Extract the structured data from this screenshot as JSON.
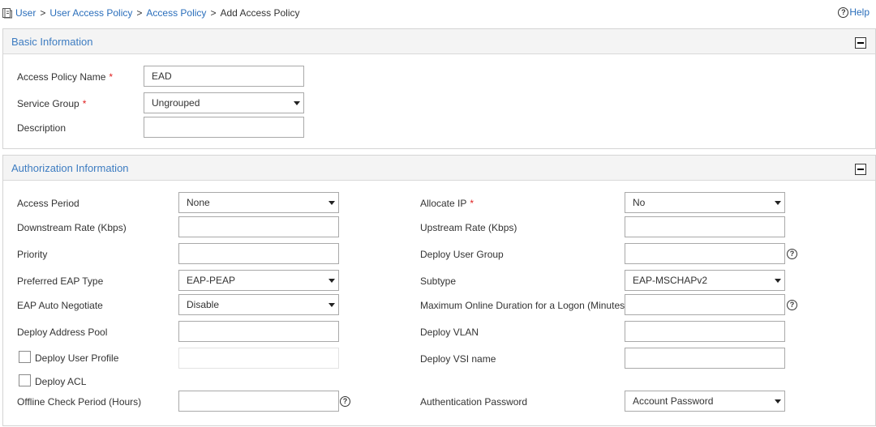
{
  "breadcrumb": {
    "items": [
      "User",
      "User Access Policy",
      "Access Policy",
      "Add Access Policy"
    ],
    "separator": ">"
  },
  "help": {
    "label": "Help"
  },
  "basic": {
    "title": "Basic Information",
    "policy_name": {
      "label": "Access Policy Name",
      "value": "EAD"
    },
    "service_group": {
      "label": "Service Group",
      "value": "Ungrouped"
    },
    "description": {
      "label": "Description",
      "value": ""
    },
    "required_mark": "*"
  },
  "auth": {
    "title": "Authorization Information",
    "access_period": {
      "label": "Access Period",
      "value": "None"
    },
    "downstream_rate": {
      "label": "Downstream Rate (Kbps)",
      "value": ""
    },
    "priority": {
      "label": "Priority",
      "value": ""
    },
    "preferred_eap_type": {
      "label": "Preferred EAP Type",
      "value": "EAP-PEAP"
    },
    "eap_auto_negotiate": {
      "label": "EAP Auto Negotiate",
      "value": "Disable"
    },
    "deploy_address_pool": {
      "label": "Deploy Address Pool",
      "value": ""
    },
    "deploy_user_profile": {
      "label": "Deploy User Profile",
      "checked": false,
      "value": ""
    },
    "deploy_acl": {
      "label": "Deploy ACL",
      "checked": false
    },
    "offline_check_period": {
      "label": "Offline Check Period (Hours)",
      "value": ""
    },
    "allocate_ip": {
      "label": "Allocate IP",
      "value": "No"
    },
    "upstream_rate": {
      "label": "Upstream Rate (Kbps)",
      "value": ""
    },
    "deploy_user_group": {
      "label": "Deploy User Group",
      "value": ""
    },
    "subtype": {
      "label": "Subtype",
      "value": "EAP-MSCHAPv2"
    },
    "max_online_duration": {
      "label": "Maximum Online Duration for a Logon (Minutes)",
      "value": ""
    },
    "deploy_vlan": {
      "label": "Deploy VLAN",
      "value": ""
    },
    "deploy_vsi_name": {
      "label": "Deploy VSI name",
      "value": ""
    },
    "auth_password": {
      "label": "Authentication Password",
      "value": "Account Password"
    }
  },
  "colors": {
    "link": "#2a6ebb",
    "section_title": "#3d7cc1",
    "required": "#e02020"
  }
}
